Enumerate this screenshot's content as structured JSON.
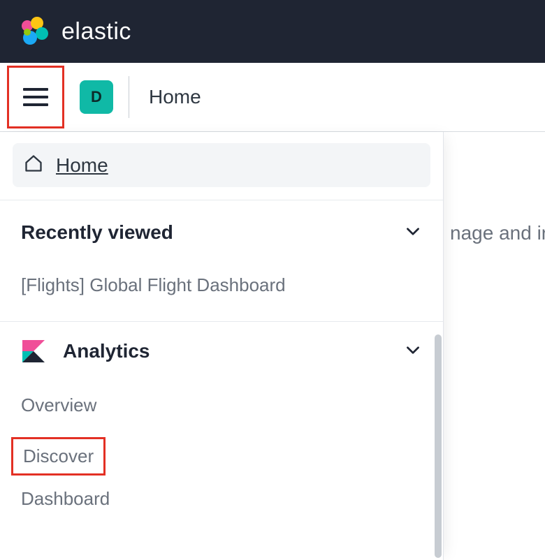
{
  "brand": {
    "name": "elastic"
  },
  "header": {
    "space_initial": "D",
    "page_title": "Home"
  },
  "sidebar": {
    "home_label": "Home",
    "recent": {
      "title": "Recently viewed",
      "items": [
        "[Flights] Global Flight Dashboard"
      ]
    },
    "analytics": {
      "title": "Analytics",
      "items": [
        "Overview",
        "Discover",
        "Dashboard"
      ]
    }
  },
  "background_fragment": "nage and ir",
  "highlights": {
    "hamburger_color": "#e33024",
    "discover_color": "#e33024"
  }
}
